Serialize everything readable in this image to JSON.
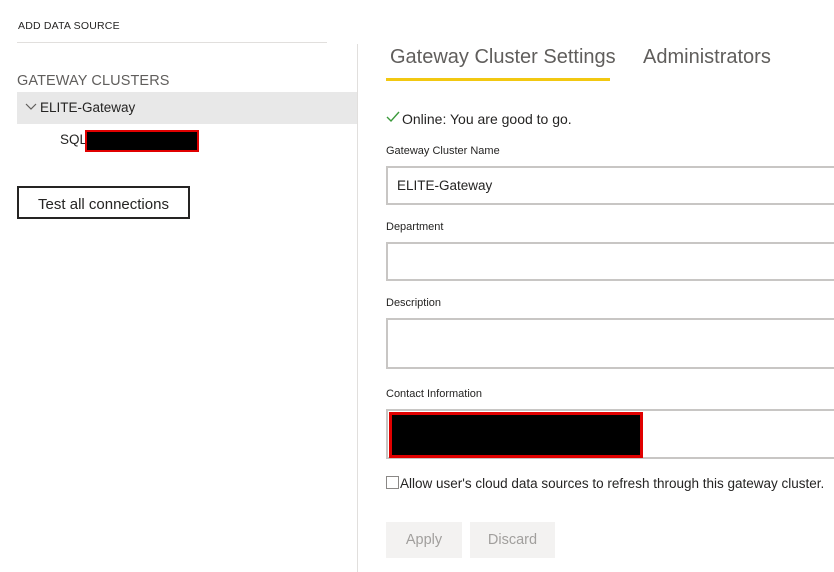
{
  "left_pane": {
    "add_data_source": "ADD DATA SOURCE",
    "clusters_heading": "GATEWAY CLUSTERS",
    "cluster": {
      "label": "ELITE-Gateway",
      "expanded": true,
      "icon": "chevron-down-icon"
    },
    "data_source": {
      "label": "SQL",
      "redacted": true
    },
    "test_button": "Test all connections"
  },
  "tabs": [
    {
      "label": "Gateway Cluster Settings",
      "active": true
    },
    {
      "label": "Administrators",
      "active": false
    }
  ],
  "status": {
    "icon": "checkmark-icon",
    "text": "Online: You are good to go.",
    "color": "#3c9a3c"
  },
  "form": {
    "name": {
      "label": "Gateway Cluster Name",
      "value": "ELITE-Gateway"
    },
    "department": {
      "label": "Department",
      "value": ""
    },
    "description": {
      "label": "Description",
      "value": ""
    },
    "contact": {
      "label": "Contact Information",
      "value": "",
      "redacted": true
    },
    "allow_cloud": {
      "label": "Allow user's cloud data sources to refresh through this gateway cluster.",
      "checked": false
    }
  },
  "actions": {
    "apply": "Apply",
    "discard": "Discard"
  },
  "colors": {
    "tab_accent": "#f2c811",
    "selected_row": "#e8e8e8",
    "redaction_border": "#e00000",
    "disabled_button_bg": "#f3f2f1",
    "disabled_button_text": "#a19f9d"
  }
}
